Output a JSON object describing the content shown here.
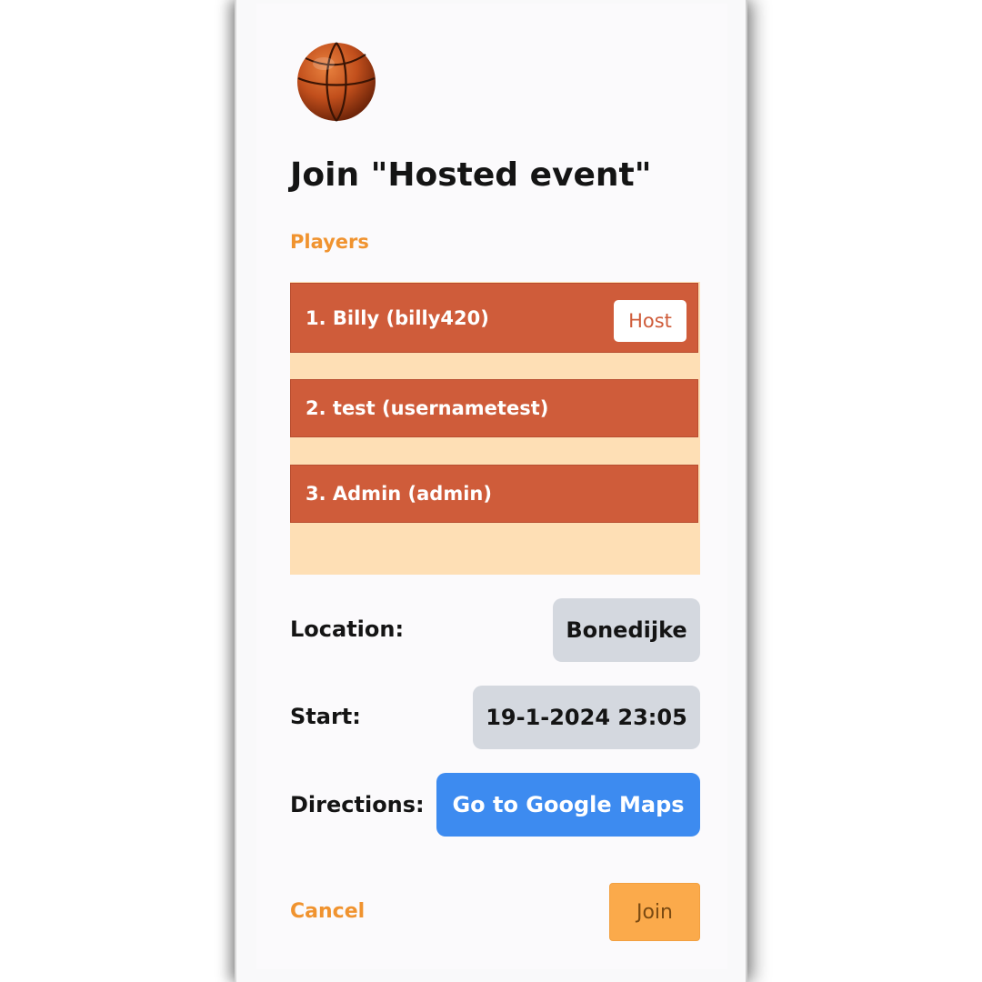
{
  "dialog": {
    "title": "Join \"Hosted event\"",
    "players_label": "Players",
    "players": [
      {
        "label": "1. Billy (billy420)",
        "badge": "Host"
      },
      {
        "label": "2. test (usernametest)"
      },
      {
        "label": "3. Admin (admin)"
      }
    ],
    "location": {
      "label": "Location:",
      "value": "Bonedijke"
    },
    "start": {
      "label": "Start:",
      "value": "19-1-2024 23:05"
    },
    "directions": {
      "label": "Directions:",
      "button": "Go to Google Maps"
    },
    "cancel_label": "Cancel",
    "join_label": "Join"
  },
  "colors": {
    "accent_orange": "#f0932f",
    "player_row": "#cf5c3a",
    "players_background": "#fedfb5",
    "maps_button": "#3d8bf0",
    "join_button": "#fbaa4b",
    "chip_gray": "#d4d8df"
  },
  "icons": {
    "logo": "basketball-icon"
  }
}
